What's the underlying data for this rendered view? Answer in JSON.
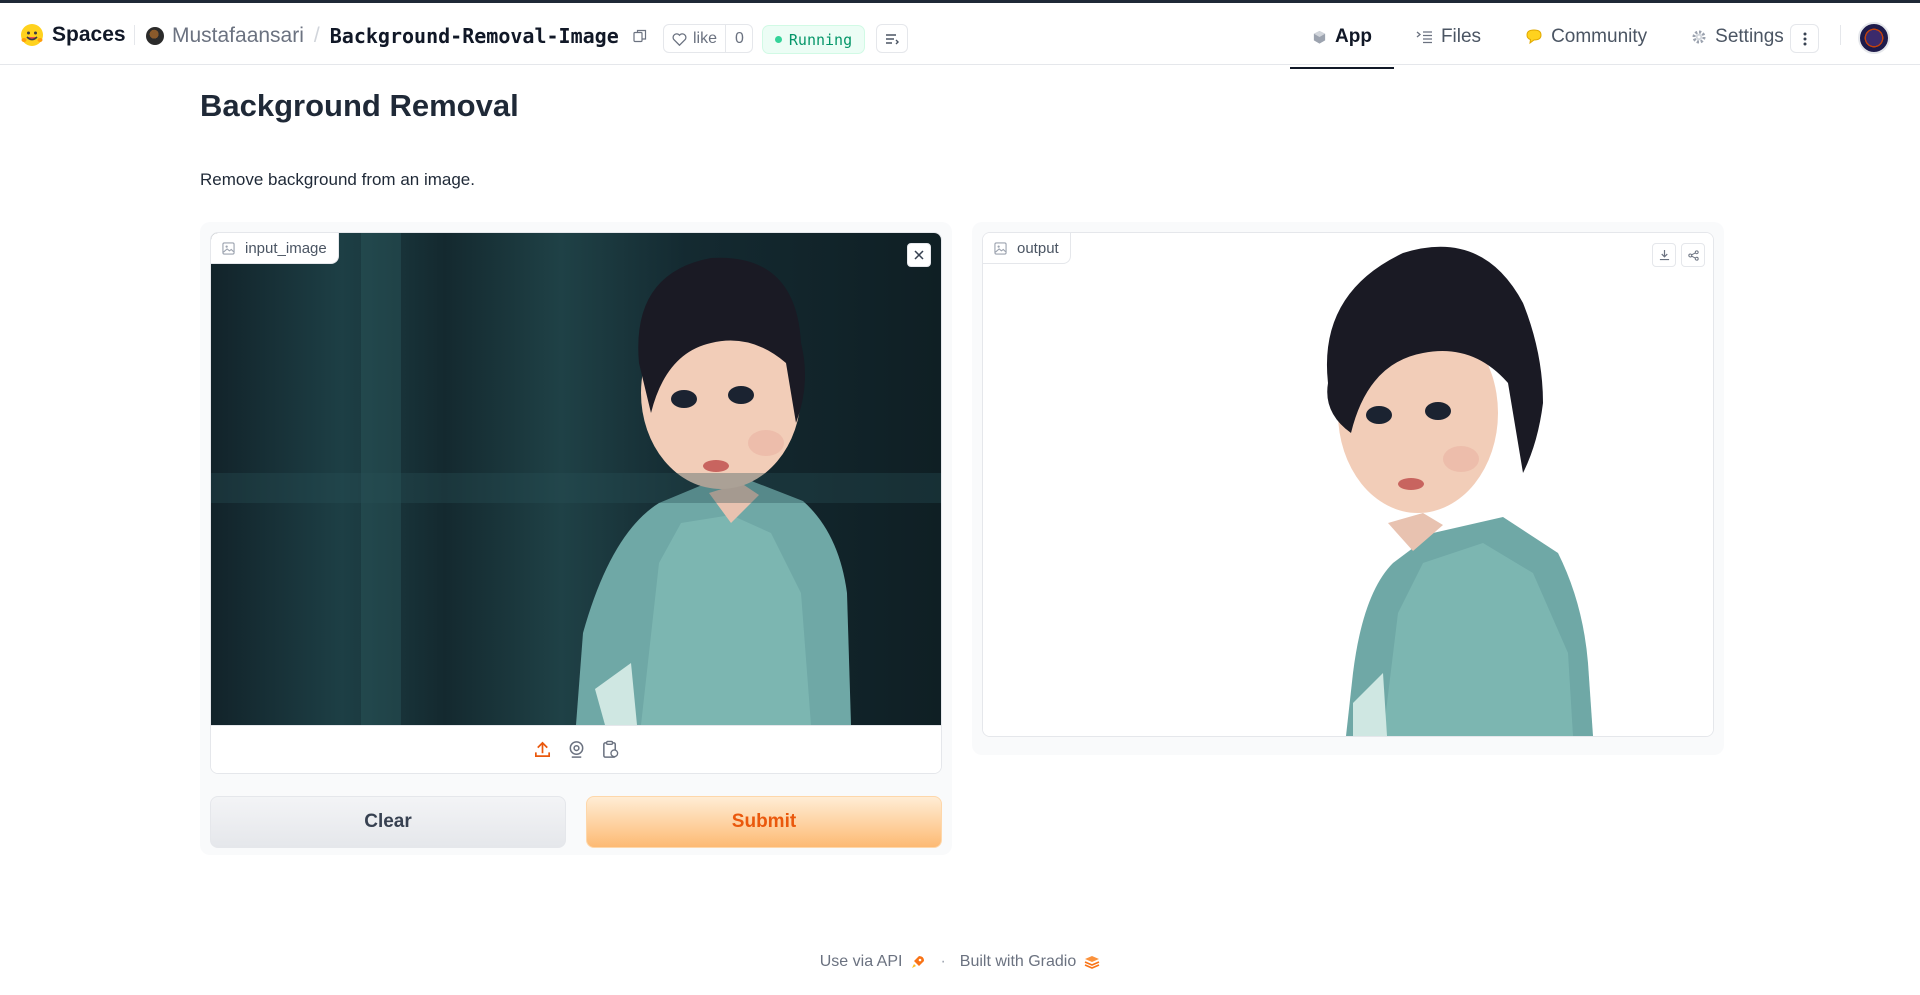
{
  "header": {
    "brand_label": "Spaces",
    "owner": "Mustafaansari",
    "separator": "/",
    "repo_name": "Background-Removal-Image",
    "like_label": "like",
    "like_count": "0",
    "status": "Running",
    "tabs": [
      {
        "label": "App",
        "active": true,
        "icon": "cube-icon"
      },
      {
        "label": "Files",
        "active": false,
        "icon": "files-icon"
      },
      {
        "label": "Community",
        "active": false,
        "icon": "community-icon"
      },
      {
        "label": "Settings",
        "active": false,
        "icon": "gear-icon"
      }
    ]
  },
  "main": {
    "title": "Background Removal",
    "description": "Remove background from an image.",
    "input": {
      "label": "input_image"
    },
    "output": {
      "label": "output"
    },
    "buttons": {
      "clear": "Clear",
      "submit": "Submit"
    }
  },
  "footer": {
    "api_label": "Use via API",
    "separator": "·",
    "built_label": "Built with Gradio"
  },
  "colors": {
    "accent": "#ea580c",
    "status": "#059669",
    "submit_bg": "#fdba74"
  }
}
